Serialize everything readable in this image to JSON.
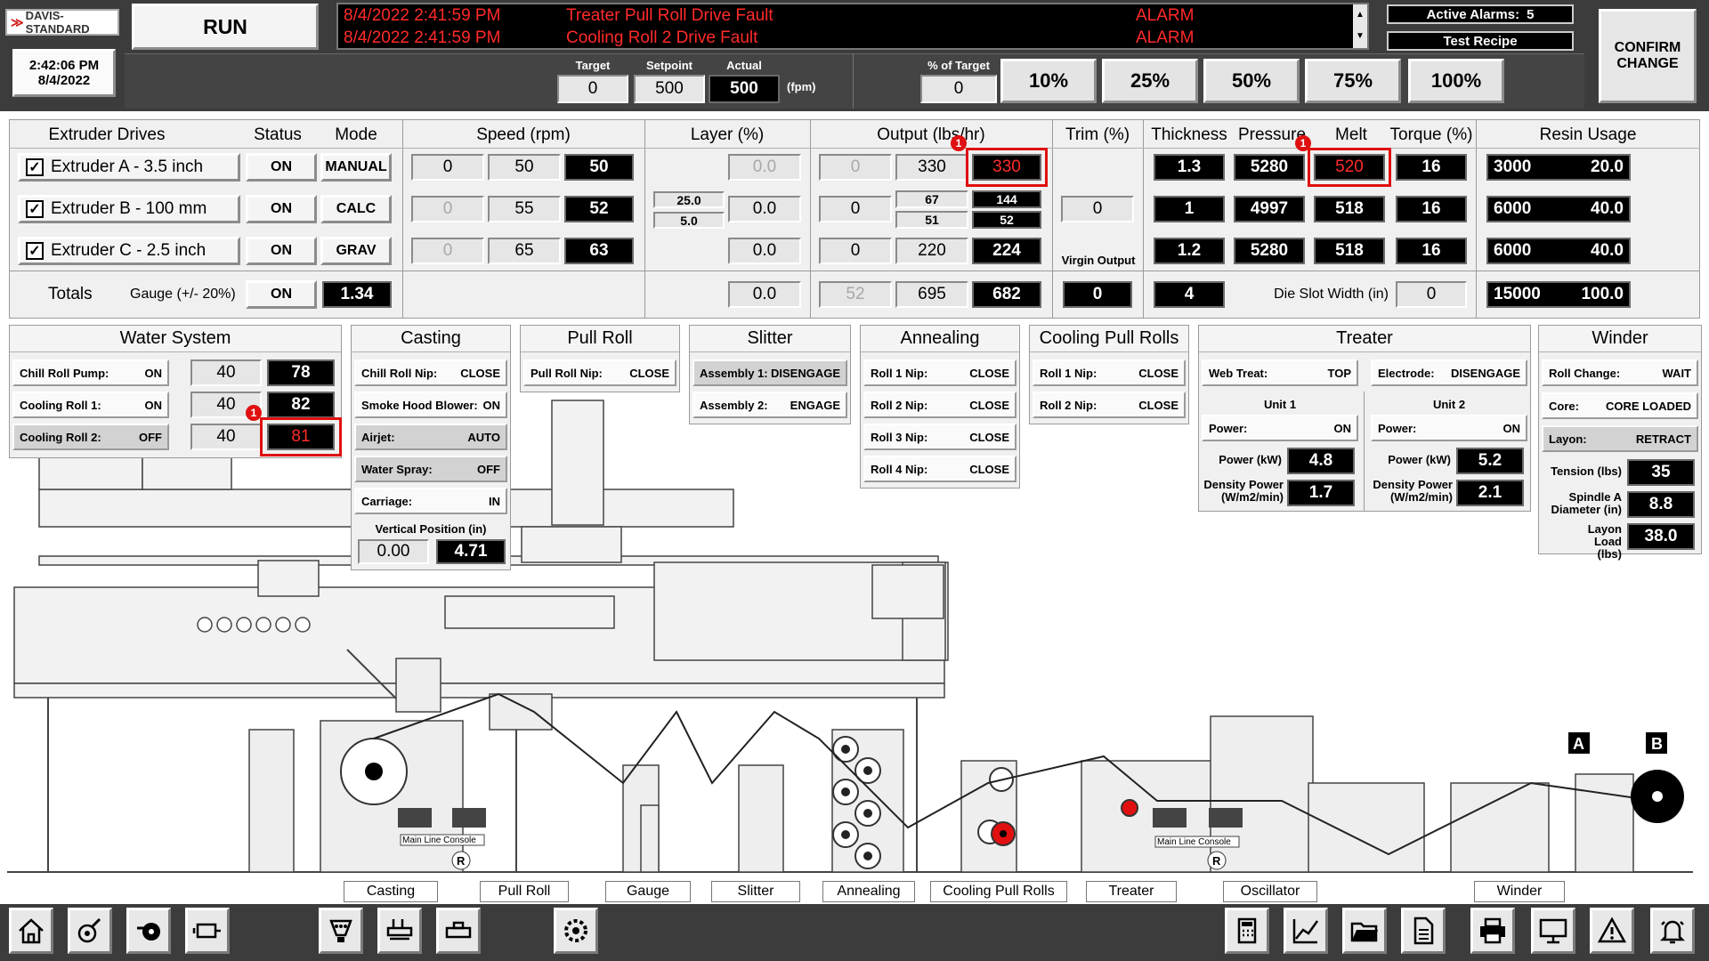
{
  "header": {
    "brand": "DAVIS-STANDARD",
    "time": "2:42:06 PM",
    "date": "8/4/2022",
    "run_label": "RUN",
    "alarms": [
      {
        "time": "8/4/2022 2:41:59 PM",
        "text": "Treater Pull Roll Drive Fault",
        "status": "ALARM"
      },
      {
        "time": "8/4/2022 2:41:59 PM",
        "text": "Cooling Roll 2 Drive Fault",
        "status": "ALARM"
      }
    ],
    "active_alarms_label": "Active Alarms:",
    "active_alarms_count": "5",
    "recipe": "Test Recipe",
    "confirm_line1": "CONFIRM",
    "confirm_line2": "CHANGE",
    "target_label": "Target",
    "setpoint_label": "Setpoint",
    "actual_label": "Actual",
    "target": "0",
    "setpoint": "500",
    "actual": "500",
    "unit": "(fpm)",
    "pct_label": "% of Target",
    "pct_value": "0",
    "pct_buttons": [
      "10%",
      "25%",
      "50%",
      "75%",
      "100%"
    ]
  },
  "extruder": {
    "headers": {
      "drives": "Extruder Drives",
      "status": "Status",
      "mode": "Mode",
      "speed": "Speed (rpm)",
      "layer": "Layer (%)",
      "output": "Output (lbs/hr)",
      "trim": "Trim (%)",
      "thickness": "Thickness",
      "pressure": "Pressure",
      "melt": "Melt",
      "torque": "Torque (%)",
      "resin": "Resin Usage"
    },
    "rows": [
      {
        "name": "Extruder A - 3.5 inch",
        "status": "ON",
        "mode": "MANUAL",
        "speed": [
          "0",
          "50",
          "50"
        ],
        "layer_sub": [
          "",
          ""
        ],
        "layer": "0.0",
        "out0": "0",
        "out1": "330",
        "out1b": "",
        "out2": "330",
        "out2b": "",
        "trim": "",
        "thickness": "1.3",
        "pressure": "5280",
        "melt": "520",
        "torque": "16",
        "resin_a": "3000",
        "resin_b": "20.0"
      },
      {
        "name": "Extruder B - 100 mm",
        "status": "ON",
        "mode": "CALC",
        "speed": [
          "0",
          "55",
          "52"
        ],
        "layer_sub": [
          "25.0",
          "5.0"
        ],
        "layer": "0.0",
        "out0": "0",
        "out1": "67",
        "out1b": "51",
        "out2": "144",
        "out2b": "52",
        "trim": "0",
        "thickness": "1",
        "pressure": "4997",
        "melt": "518",
        "torque": "16",
        "resin_a": "6000",
        "resin_b": "40.0"
      },
      {
        "name": "Extruder C - 2.5 inch",
        "status": "ON",
        "mode": "GRAV",
        "speed": [
          "0",
          "65",
          "63"
        ],
        "layer_sub": [
          "",
          ""
        ],
        "layer": "0.0",
        "out0": "0",
        "out1": "220",
        "out1b": "",
        "out2": "224",
        "out2b": "",
        "trim": "",
        "thickness": "1.2",
        "pressure": "5280",
        "melt": "518",
        "torque": "16",
        "resin_a": "6000",
        "resin_b": "40.0"
      }
    ],
    "totals": {
      "label": "Totals",
      "gauge_label": "Gauge (+/- 20%)",
      "status": "ON",
      "gauge": "1.34",
      "layer": "0.0",
      "out0": "52",
      "out1": "695",
      "out2": "682",
      "virgin_label": "Virgin Output",
      "virgin": "0",
      "thickness": "4",
      "die_label": "Die Slot Width (in)",
      "die": "0",
      "resin_a": "15000",
      "resin_b": "100.0"
    }
  },
  "water": {
    "title": "Water System",
    "rows": [
      {
        "label": "Chill Roll Pump:",
        "state": "ON",
        "sp": "40",
        "pv": "78"
      },
      {
        "label": "Cooling Roll 1:",
        "state": "ON",
        "sp": "40",
        "pv": "82"
      },
      {
        "label": "Cooling Roll 2:",
        "state": "OFF",
        "sp": "40",
        "pv": "81"
      }
    ]
  },
  "casting": {
    "title": "Casting",
    "rows": [
      {
        "label": "Chill Roll Nip:",
        "state": "CLOSE"
      },
      {
        "label": "Smoke Hood Blower:",
        "state": "ON"
      },
      {
        "label": "Airjet:",
        "state": "AUTO"
      },
      {
        "label": "Water Spray:",
        "state": "OFF"
      },
      {
        "label": "Carriage:",
        "state": "IN"
      }
    ],
    "vpos_label": "Vertical Position (in)",
    "vpos_sp": "0.00",
    "vpos_pv": "4.71"
  },
  "pullroll": {
    "title": "Pull Roll",
    "rows": [
      {
        "label": "Pull Roll Nip:",
        "state": "CLOSE"
      }
    ]
  },
  "slitter": {
    "title": "Slitter",
    "rows": [
      {
        "label": "Assembly 1:",
        "state": "DISENGAGE"
      },
      {
        "label": "Assembly 2:",
        "state": "ENGAGE"
      }
    ]
  },
  "annealing": {
    "title": "Annealing",
    "rows": [
      {
        "label": "Roll 1 Nip:",
        "state": "CLOSE"
      },
      {
        "label": "Roll 2 Nip:",
        "state": "CLOSE"
      },
      {
        "label": "Roll 3 Nip:",
        "state": "CLOSE"
      },
      {
        "label": "Roll 4 Nip:",
        "state": "CLOSE"
      }
    ]
  },
  "coolingpull": {
    "title": "Cooling Pull Rolls",
    "rows": [
      {
        "label": "Roll 1 Nip:",
        "state": "CLOSE"
      },
      {
        "label": "Roll 2 Nip:",
        "state": "CLOSE"
      }
    ]
  },
  "treater": {
    "title": "Treater",
    "web_label": "Web Treat:",
    "web": "TOP",
    "elec_label": "Electrode:",
    "elec": "DISENGAGE",
    "units": [
      {
        "title": "Unit 1",
        "power_label": "Power:",
        "power": "ON",
        "kw_label": "Power (kW)",
        "kw": "4.8",
        "dens_label": "Density Power (W/m2/min)",
        "dens": "1.7"
      },
      {
        "title": "Unit 2",
        "power_label": "Power:",
        "power": "ON",
        "kw_label": "Power (kW)",
        "kw": "5.2",
        "dens_label": "Density Power (W/m2/min)",
        "dens": "2.1"
      }
    ]
  },
  "winder": {
    "title": "Winder",
    "rows": [
      {
        "label": "Roll Change:",
        "state": "WAIT"
      },
      {
        "label": "Core:",
        "state": "CORE LOADED"
      },
      {
        "label": "Layon:",
        "state": "RETRACT"
      }
    ],
    "tension_label": "Tension (lbs)",
    "tension": "35",
    "spindle_label": "Spindle A Diameter (in)",
    "spindle": "8.8",
    "layon_label": "Layon Load (lbs)",
    "layon": "38.0"
  },
  "diagram": {
    "console1": "Main Line Console",
    "console2": "Main Line Console",
    "r": "R",
    "a": "A",
    "b": "B"
  },
  "sections": [
    "Casting",
    "Pull Roll",
    "Gauge",
    "Slitter",
    "Annealing",
    "Cooling Pull Rolls",
    "Treater",
    "Oscillator",
    "Winder"
  ],
  "badge": "1"
}
